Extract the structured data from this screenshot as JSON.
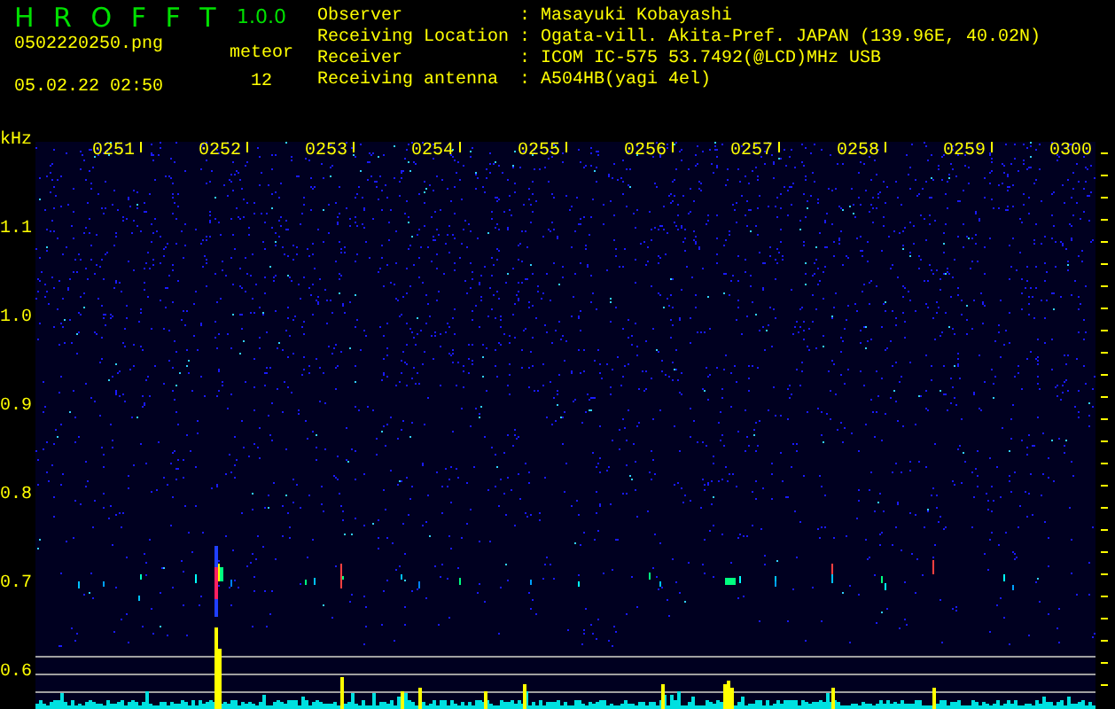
{
  "app": {
    "name": "H R O F F T",
    "version": "1.0.0"
  },
  "file": "0502220250.png",
  "datetime": "05.02.22 02:50",
  "meteor": {
    "label": "meteor",
    "count": "12"
  },
  "info": [
    {
      "label": "Observer",
      "separator": ":",
      "value": "Masayuki Kobayashi"
    },
    {
      "label": "Receiving Location",
      "separator": ":",
      "value": "Ogata-vill. Akita-Pref. JAPAN (139.96E, 40.02N)"
    },
    {
      "label": "Receiver",
      "separator": ":",
      "value": "ICOM IC-575 53.7492(@LCD)MHz USB"
    },
    {
      "label": "Receiving antenna",
      "separator": ":",
      "value": "A504HB(yagi 4el)"
    }
  ],
  "spectrogram": {
    "unit": "kHz",
    "time_labels": [
      "0251",
      "0252",
      "0253",
      "0254",
      "0255",
      "0256",
      "0257",
      "0258",
      "0259",
      "0300"
    ],
    "freq_labels": [
      "1.1",
      "1.0",
      "0.9",
      "0.8",
      "0.7",
      "0.6"
    ]
  }
}
